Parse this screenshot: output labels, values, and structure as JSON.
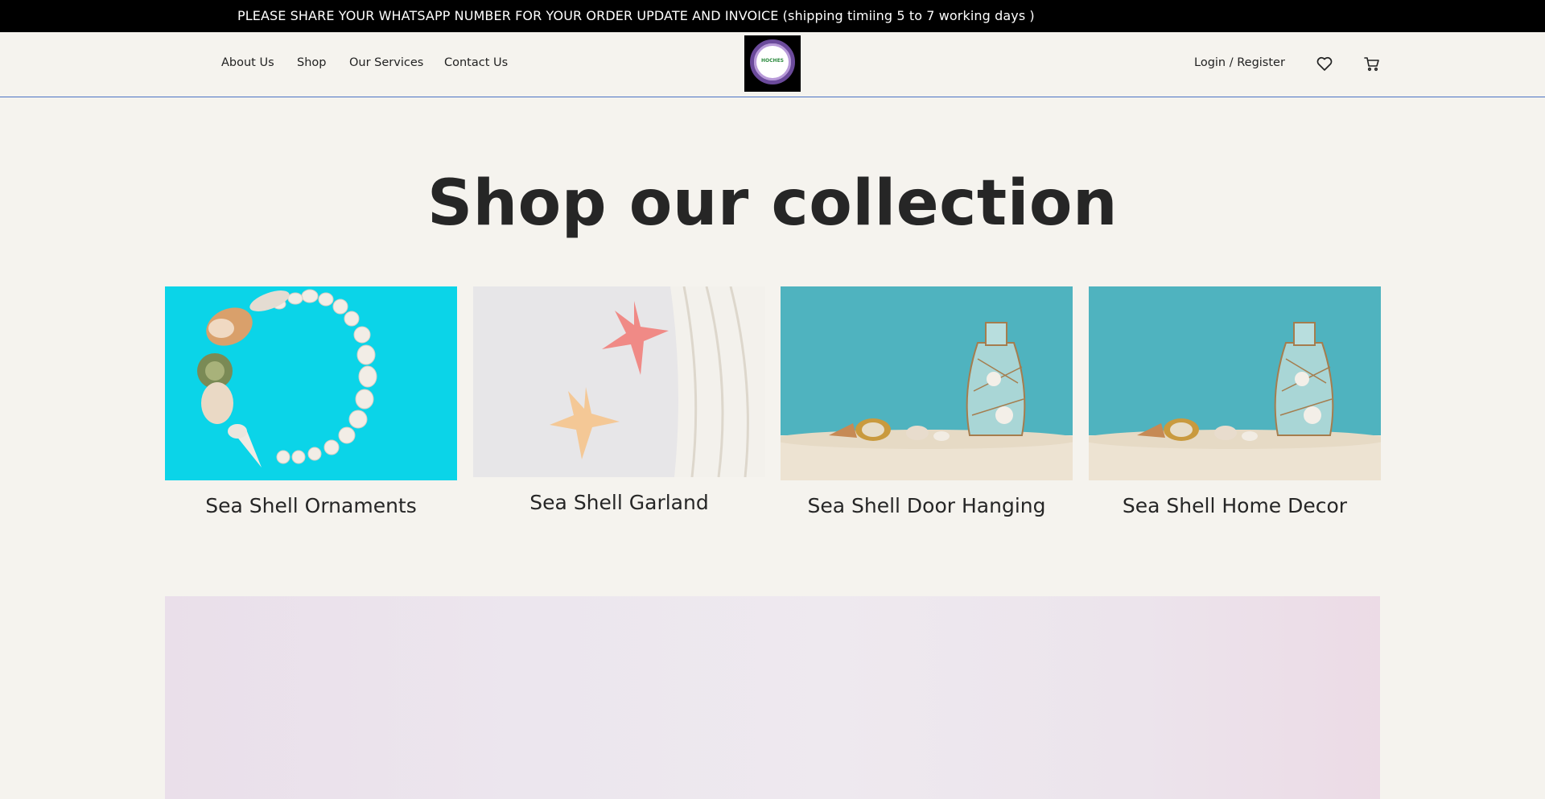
{
  "announcement": "PLEASE SHARE YOUR WHATSAPP NUMBER FOR YOUR ORDER UPDATE AND INVOICE (shipping timiing 5 to 7 working days )",
  "nav": {
    "links": [
      "About Us",
      "Shop",
      "Our Services",
      "Contact Us"
    ],
    "logo_text": "HOCHES",
    "login_label": "Login / Register",
    "wishlist_icon": "heart-icon",
    "cart_icon": "cart-icon"
  },
  "collection": {
    "title": "Shop our collection",
    "items": [
      {
        "label": "Sea Shell Ornaments",
        "image": "shells-circle-on-turquoise"
      },
      {
        "label": "Sea Shell Garland",
        "image": "starfish-on-white-towel"
      },
      {
        "label": "Sea Shell Door Hanging",
        "image": "glass-bottle-compass-sand"
      },
      {
        "label": "Sea Shell Home Decor",
        "image": "glass-bottle-compass-sand"
      }
    ]
  },
  "colors": {
    "topbar_bg": "#000000",
    "page_bg": "#f5f3ee",
    "header_border": "#4a72c4",
    "banner_bg": "#ece6ee"
  }
}
